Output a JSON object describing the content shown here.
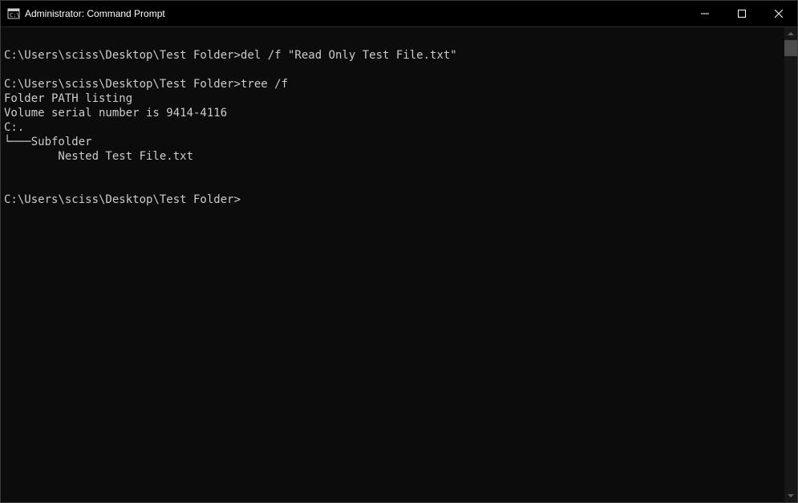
{
  "window": {
    "title": "Administrator: Command Prompt"
  },
  "terminal": {
    "lines": [
      {
        "type": "blank",
        "text": ""
      },
      {
        "type": "cmd",
        "prompt": "C:\\Users\\sciss\\Desktop\\Test Folder>",
        "command": "del /f \"Read Only Test File.txt\""
      },
      {
        "type": "blank",
        "text": ""
      },
      {
        "type": "cmd",
        "prompt": "C:\\Users\\sciss\\Desktop\\Test Folder>",
        "command": "tree /f"
      },
      {
        "type": "out",
        "text": "Folder PATH listing"
      },
      {
        "type": "out",
        "text": "Volume serial number is 9414-4116"
      },
      {
        "type": "out",
        "text": "C:."
      },
      {
        "type": "out",
        "text": "└───Subfolder"
      },
      {
        "type": "out",
        "text": "        Nested Test File.txt"
      },
      {
        "type": "blank",
        "text": ""
      },
      {
        "type": "blank",
        "text": ""
      },
      {
        "type": "cmd",
        "prompt": "C:\\Users\\sciss\\Desktop\\Test Folder>",
        "command": ""
      }
    ]
  }
}
